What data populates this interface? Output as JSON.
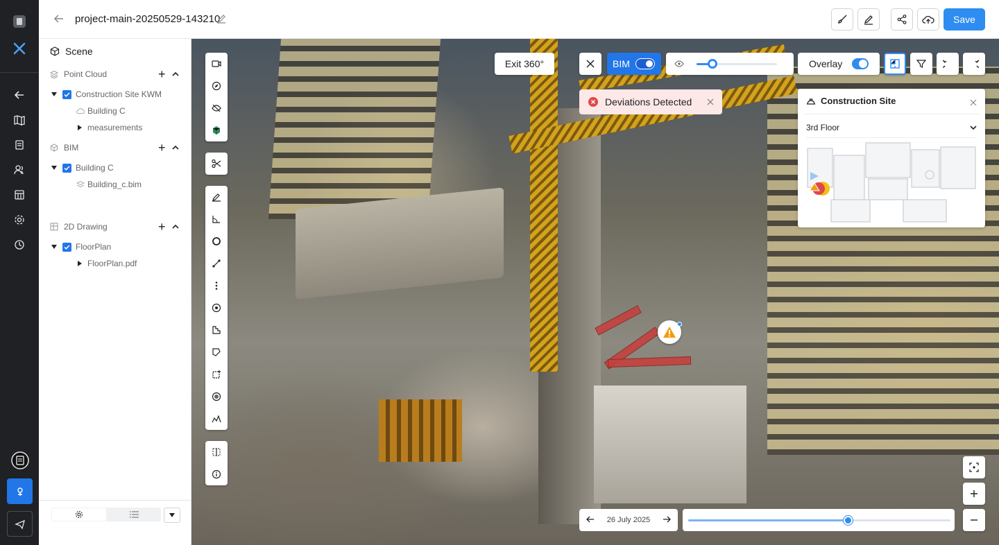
{
  "topbar": {
    "title": "project-main-20250529-143210",
    "save_label": "Save"
  },
  "scene": {
    "title": "Scene",
    "groups": [
      {
        "label": "Point Cloud",
        "items": [
          {
            "label": "Construction Site KWM",
            "children": [
              "Building C",
              "measurements"
            ]
          }
        ]
      },
      {
        "label": "BIM",
        "items": [
          {
            "label": "Building C",
            "children": [
              "Building_c.bim"
            ]
          }
        ]
      },
      {
        "label": "2D Drawing",
        "items": [
          {
            "label": "FloorPlan",
            "children": [
              "FloorPlan.pdf"
            ]
          }
        ]
      }
    ]
  },
  "viewer": {
    "exit_label": "Exit 360°",
    "bim_label": "BIM",
    "bim_on": true,
    "overlay_label": "Overlay",
    "overlay_on": true,
    "opacity_value": 0.17,
    "alert_text": "Deviations Detected",
    "map_title": "Construction Site",
    "map_floor": "3rd Floor",
    "date_label": "26 July 2025",
    "timeline_value": 0.61
  },
  "colors": {
    "accent": "#2f8cf0",
    "bim_toggle": "#1d5fd1",
    "alert_bg": "#fde8e8",
    "alert_icon": "#e04848",
    "warning": "#f39c12"
  }
}
